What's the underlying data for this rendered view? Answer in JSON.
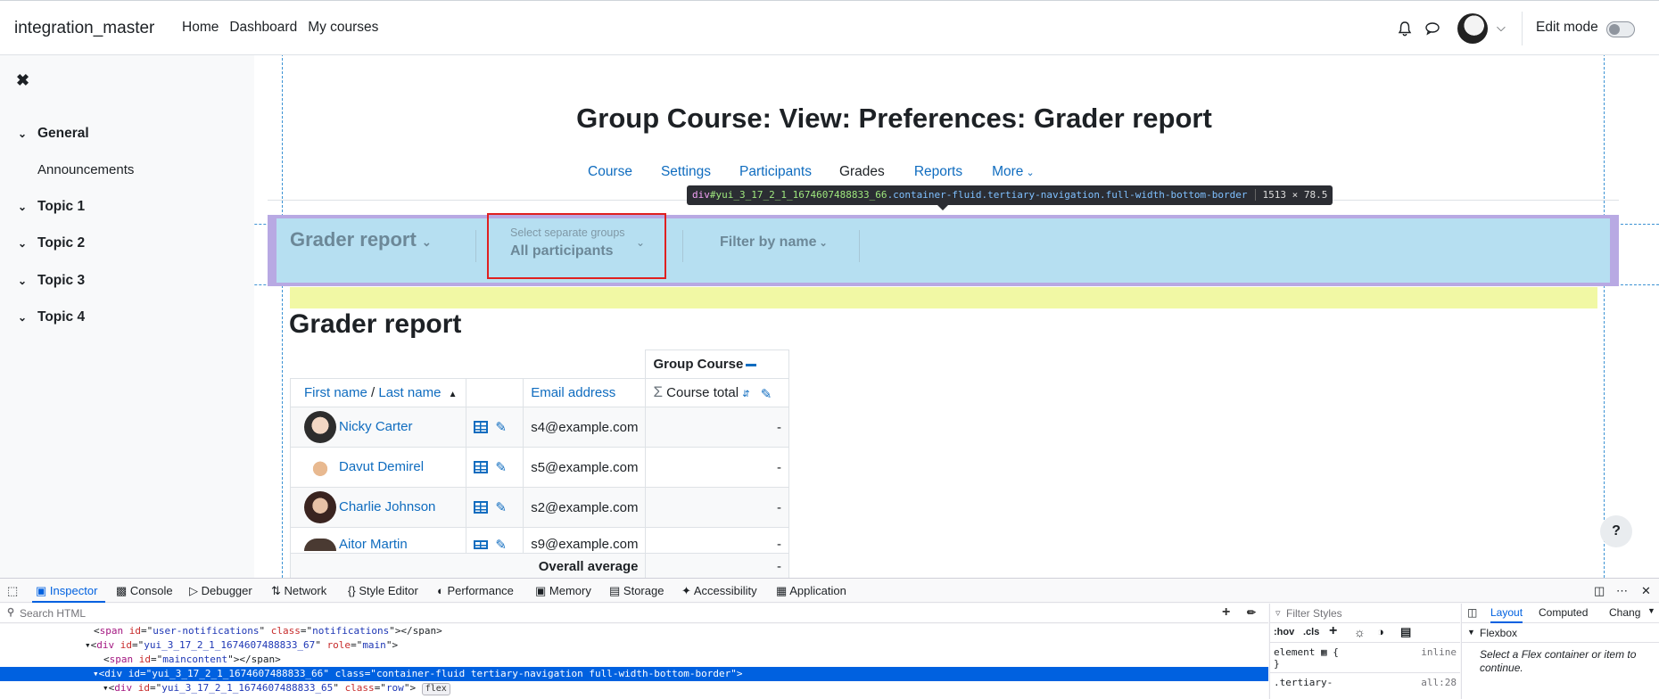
{
  "app": {
    "brand": "integration_master"
  },
  "topnav": {
    "items": [
      "Home",
      "Dashboard",
      "My courses"
    ]
  },
  "user": {
    "edit_mode_label": "Edit mode",
    "edit_mode_on": false
  },
  "drawer": {
    "sections": [
      {
        "label": "General",
        "children": [
          "Announcements"
        ]
      },
      {
        "label": "Topic 1",
        "children": []
      },
      {
        "label": "Topic 2",
        "children": []
      },
      {
        "label": "Topic 3",
        "children": []
      },
      {
        "label": "Topic 4",
        "children": []
      }
    ]
  },
  "page": {
    "title": "Group Course: View: Preferences: Grader report",
    "secondary_nav": [
      "Course",
      "Settings",
      "Participants",
      "Grades",
      "Reports",
      "More"
    ],
    "secondary_nav_active": "Grades",
    "report_selector": "Grader report",
    "group_selector": {
      "label": "Select separate groups",
      "value": "All participants"
    },
    "filter_by_name": "Filter by name",
    "heading": "Grader report"
  },
  "table": {
    "course_header": "Group Course",
    "col_first_name": "First name",
    "col_slash": " / ",
    "col_last_name": "Last name",
    "col_email": "Email address",
    "col_total": "Course total",
    "rows": [
      {
        "name": "Nicky Carter",
        "email": "s4@example.com",
        "total": "-"
      },
      {
        "name": "Davut Demirel",
        "email": "s5@example.com",
        "total": "-"
      },
      {
        "name": "Charlie Johnson",
        "email": "s2@example.com",
        "total": "-"
      },
      {
        "name": "Aitor Martin",
        "email": "s9@example.com",
        "total": "-"
      }
    ],
    "overall_label": "Overall average",
    "overall_value": "-"
  },
  "inspector_tooltip": {
    "tag": "div",
    "id": "#yui_3_17_2_1_1674607488833_66",
    "classes": ".container-fluid.tertiary-navigation.full-width-bottom-border",
    "dims": "1513 × 78.5"
  },
  "devtools": {
    "tabs": [
      "Inspector",
      "Console",
      "Debugger",
      "Network",
      "Style Editor",
      "Performance",
      "Memory",
      "Storage",
      "Accessibility",
      "Application"
    ],
    "active_tab": "Inspector",
    "search_placeholder": "Search HTML",
    "filter_styles_placeholder": "Filter Styles",
    "styles_toggles": [
      ":hov",
      ".cls"
    ],
    "style_rule_selector": "element",
    "style_rule_open": " {",
    "style_rule_close": "}",
    "style_rule_meta": "inline",
    "style_rule2_selector": ".tertiary-",
    "style_rule2_meta": "all:28",
    "layout_tabs": [
      "Layout",
      "Computed",
      "Chang"
    ],
    "flexbox_label": "Flexbox",
    "flexbox_hint": "Select a Flex container or item to continue.",
    "html_lines": [
      {
        "indent": 88,
        "tag": "span",
        "id": "user-notifications",
        "cls": "notifications",
        "close": "></span>",
        "role": ""
      },
      {
        "indent": 80,
        "tag": "div",
        "id": "yui_3_17_2_1_1674607488833_67",
        "cls": "",
        "close": ">",
        "role": "main"
      },
      {
        "indent": 96,
        "tag": "span",
        "id": "maincontent",
        "cls": "",
        "close": "></span>",
        "role": ""
      },
      {
        "indent": 88,
        "tag": "div",
        "id": "yui_3_17_2_1_1674607488833_66",
        "cls": "container-fluid tertiary-navigation full-width-bottom-border",
        "close": ">",
        "role": ""
      },
      {
        "indent": 96,
        "tag": "div",
        "id": "yui_3_17_2_1_1674607488833_65",
        "cls": "row",
        "close": ">",
        "role": ""
      }
    ],
    "flex_badge": "flex"
  }
}
